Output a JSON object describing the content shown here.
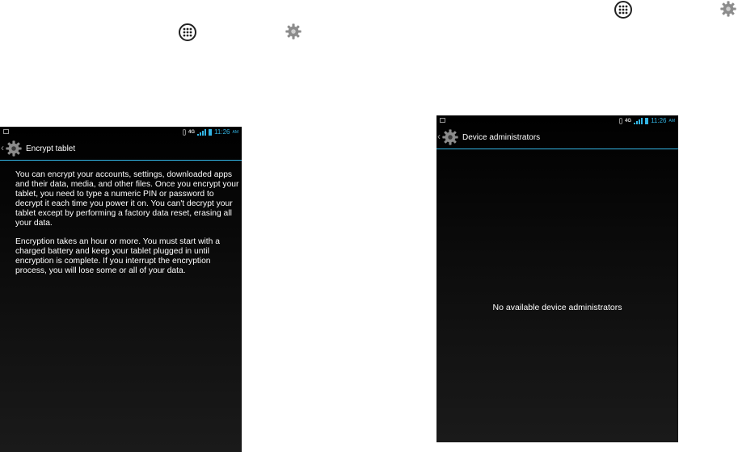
{
  "left_screen": {
    "status_bar": {
      "network": "4G",
      "time": "11:26",
      "ampm": "AM"
    },
    "title": "Encrypt tablet",
    "paragraphs": [
      "You can encrypt your accounts, settings, downloaded apps and their data, media, and other files. Once you encrypt your tablet, you need to type a numeric PIN or password to decrypt it each time you power it on. You can't decrypt your tablet except by performing a factory data reset, erasing all your data.",
      "Encryption takes an hour or more. You must start with a charged battery and keep your tablet plugged in until encryption is complete. If you interrupt the encryption process, you will lose some or all of your data."
    ]
  },
  "right_screen": {
    "status_bar": {
      "network": "4G",
      "time": "11:26",
      "ampm": "AM"
    },
    "title": "Device administrators",
    "empty_message": "No available device administrators"
  },
  "icons": {
    "apps": "apps-icon",
    "settings": "settings-gear-icon",
    "back": "back-caret-icon",
    "bluetooth": "bluetooth-icon",
    "signal": "signal-icon",
    "battery": "battery-icon",
    "notification": "notification-icon"
  },
  "colors": {
    "accent": "#33b5e5",
    "screen_bg": "#000000",
    "text": "#ffffff",
    "gear": "#8c8c8c"
  }
}
